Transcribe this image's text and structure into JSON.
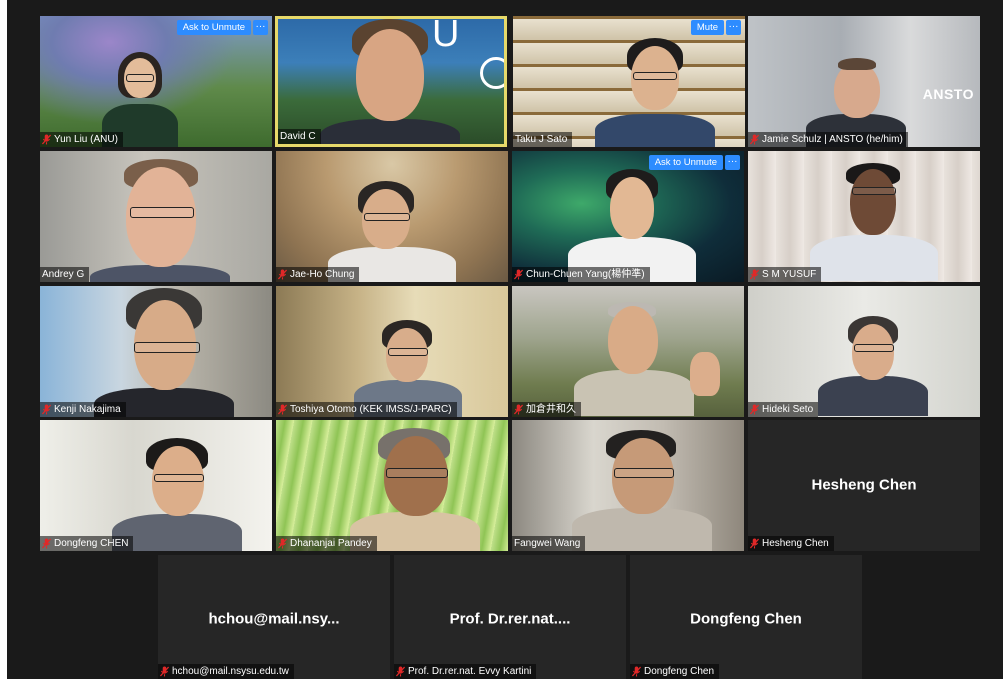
{
  "app": {
    "name": "Zoom",
    "view": "Gallery view"
  },
  "controls": {
    "ask_to_unmute": "Ask to Unmute",
    "mute": "Mute",
    "more": "···"
  },
  "participants": [
    {
      "name": "Yun Liu (ANU)",
      "muted": true,
      "active_speaker": false
    },
    {
      "name": "David C",
      "muted": false,
      "active_speaker": true
    },
    {
      "name": "Taku J Sato",
      "muted": false,
      "active_speaker": false
    },
    {
      "name": "Jamie Schulz | ANSTO (he/him)",
      "muted": true,
      "active_speaker": false,
      "background_text": "ANSTO"
    },
    {
      "name": "Andrey G",
      "muted": false,
      "active_speaker": false
    },
    {
      "name": "Jae-Ho Chung",
      "muted": true,
      "active_speaker": false
    },
    {
      "name": "Chun-Chuen Yang(楊仲準)",
      "muted": true,
      "active_speaker": false
    },
    {
      "name": "S M YUSUF",
      "muted": true,
      "active_speaker": false
    },
    {
      "name": "Kenji Nakajima",
      "muted": true,
      "active_speaker": false
    },
    {
      "name": "Toshiya Otomo (KEK IMSS/J-PARC)",
      "muted": true,
      "active_speaker": false
    },
    {
      "name": "加倉井和久",
      "muted": true,
      "active_speaker": false
    },
    {
      "name": "Hideki Seto",
      "muted": true,
      "active_speaker": false
    },
    {
      "name": "Dongfeng CHEN",
      "muted": true,
      "active_speaker": false
    },
    {
      "name": "Dhananjai Pandey",
      "muted": true,
      "active_speaker": false
    },
    {
      "name": "Fangwei Wang",
      "muted": false,
      "active_speaker": false
    },
    {
      "name": "Hesheng Chen",
      "muted": true,
      "video_off": true,
      "display_name": "Hesheng Chen"
    },
    {
      "name": "hchou@mail.nsysu.edu.tw",
      "muted": true,
      "video_off": true,
      "display_name": "hchou@mail.nsy..."
    },
    {
      "name": "Prof. Dr.rer.nat. Evvy Kartini",
      "muted": true,
      "video_off": true,
      "display_name": "Prof. Dr.rer.nat...."
    },
    {
      "name": "Dongfeng Chen",
      "muted": true,
      "video_off": true,
      "display_name": "Dongfeng Chen"
    }
  ],
  "colors": {
    "stage": "#1a1a1a",
    "tile_off": "#2b2b2b",
    "active_border": "#e6d96a",
    "accent": "#2d8cff",
    "mic_off": "#e02828"
  }
}
